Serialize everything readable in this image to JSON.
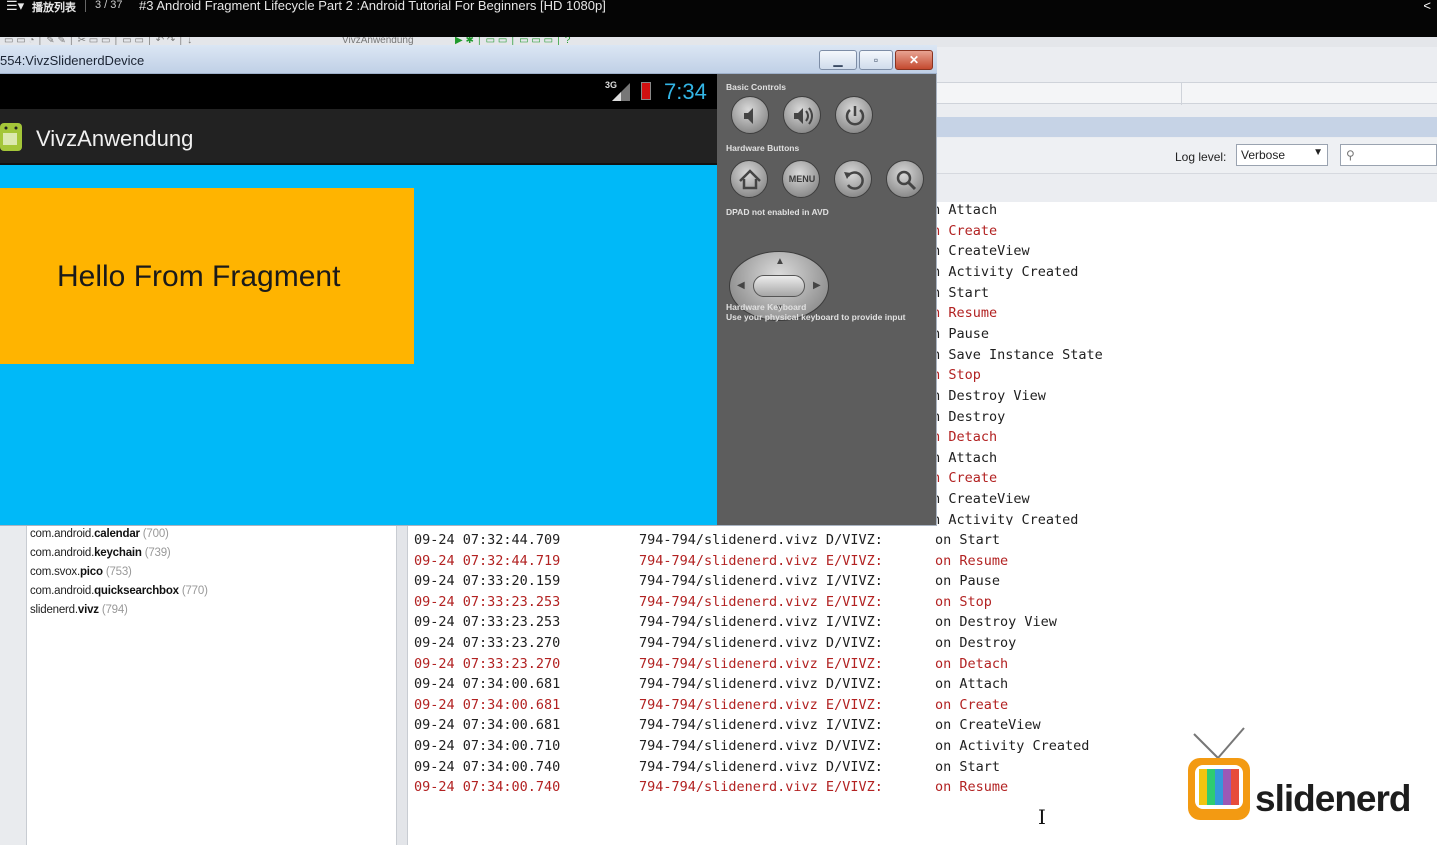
{
  "video_bar": {
    "playlist_icon": "list-icon",
    "playlist_label": "播放列表",
    "position": "3 / 37",
    "title": "#3 Android Fragment Lifecycle Part 2 :Android Tutorial For Beginners [HD 1080p]",
    "share_icon": "share-icon"
  },
  "ide": {
    "toolbar_run_config": "VivzAnwendung",
    "log_level_label": "Log level:",
    "log_level_value": "Verbose",
    "search_icon": "search-icon"
  },
  "emulator": {
    "window_title": "554:VivzSlidenerdDevice",
    "status_net": "3G",
    "clock": "7:34",
    "app_name": "VivzAnwendung",
    "fragment_text": "Hello From Fragment",
    "colors": {
      "content_bg": "#00b9f8",
      "fragment_bg": "#ffb400",
      "actionbar": "#222222"
    },
    "controls": {
      "basic_label": "Basic Controls",
      "hardware_label": "Hardware Buttons",
      "menu_label": "MENU",
      "dpad_label": "DPAD not enabled in AVD",
      "keyboard_label": "Hardware Keyboard",
      "keyboard_sub": "Use your physical keyboard to provide input",
      "icons": [
        "volume-down-icon",
        "volume-up-icon",
        "power-icon",
        "home-icon",
        "menu-icon",
        "back-icon",
        "search-icon"
      ]
    }
  },
  "processes": [
    {
      "prefix": "com.android.",
      "bold": "calendar",
      "pid": "(700)"
    },
    {
      "prefix": "com.android.",
      "bold": "keychain",
      "pid": "(739)"
    },
    {
      "prefix": "com.svox.",
      "bold": "pico",
      "pid": "(753)"
    },
    {
      "prefix": "com.android.",
      "bold": "quicksearchbox",
      "pid": "(770)"
    },
    {
      "prefix": "slidenerd.",
      "bold": "vivz",
      "pid": "(794)"
    }
  ],
  "upper_log_messages": [
    {
      "text": "on Attach",
      "level": "D"
    },
    {
      "text": "on Create",
      "level": "E"
    },
    {
      "text": "on CreateView",
      "level": "I"
    },
    {
      "text": "on Activity Created",
      "level": "D"
    },
    {
      "text": "on Start",
      "level": "D"
    },
    {
      "text": "on Resume",
      "level": "E"
    },
    {
      "text": "on Pause",
      "level": "I"
    },
    {
      "text": "on Save Instance State",
      "level": "D"
    },
    {
      "text": "on Stop",
      "level": "E"
    },
    {
      "text": "on Destroy View",
      "level": "I"
    },
    {
      "text": "on Destroy",
      "level": "D"
    },
    {
      "text": "on Detach",
      "level": "E"
    },
    {
      "text": "on Attach",
      "level": "D"
    },
    {
      "text": "on Create",
      "level": "E"
    },
    {
      "text": "on CreateView",
      "level": "I"
    },
    {
      "text": "on Activity Created",
      "level": "D"
    }
  ],
  "log_lines": [
    {
      "time": "09-24 07:32:44.709",
      "tag": "794-794/slidenerd.vivz D/VIVZ:",
      "msg": "on Start",
      "level": "D"
    },
    {
      "time": "09-24 07:32:44.719",
      "tag": "794-794/slidenerd.vivz E/VIVZ:",
      "msg": "on Resume",
      "level": "E"
    },
    {
      "time": "09-24 07:33:20.159",
      "tag": "794-794/slidenerd.vivz I/VIVZ:",
      "msg": "on Pause",
      "level": "I"
    },
    {
      "time": "09-24 07:33:23.253",
      "tag": "794-794/slidenerd.vivz E/VIVZ:",
      "msg": "on Stop",
      "level": "E"
    },
    {
      "time": "09-24 07:33:23.253",
      "tag": "794-794/slidenerd.vivz I/VIVZ:",
      "msg": "on Destroy View",
      "level": "I"
    },
    {
      "time": "09-24 07:33:23.270",
      "tag": "794-794/slidenerd.vivz D/VIVZ:",
      "msg": "on Destroy",
      "level": "D"
    },
    {
      "time": "09-24 07:33:23.270",
      "tag": "794-794/slidenerd.vivz E/VIVZ:",
      "msg": "on Detach",
      "level": "E"
    },
    {
      "time": "09-24 07:34:00.681",
      "tag": "794-794/slidenerd.vivz D/VIVZ:",
      "msg": "on Attach",
      "level": "D"
    },
    {
      "time": "09-24 07:34:00.681",
      "tag": "794-794/slidenerd.vivz E/VIVZ:",
      "msg": "on Create",
      "level": "E"
    },
    {
      "time": "09-24 07:34:00.681",
      "tag": "794-794/slidenerd.vivz I/VIVZ:",
      "msg": "on CreateView",
      "level": "I"
    },
    {
      "time": "09-24 07:34:00.710",
      "tag": "794-794/slidenerd.vivz D/VIVZ:",
      "msg": "on Activity Created",
      "level": "D"
    },
    {
      "time": "09-24 07:34:00.740",
      "tag": "794-794/slidenerd.vivz D/VIVZ:",
      "msg": "on Start",
      "level": "D"
    },
    {
      "time": "09-24 07:34:00.740",
      "tag": "794-794/slidenerd.vivz E/VIVZ:",
      "msg": "on Resume",
      "level": "E"
    }
  ],
  "log_colors": {
    "D": "#202020",
    "I": "#202020",
    "E": "#b22222"
  },
  "logo": {
    "text": "slidenerd",
    "icon": "tv-icon"
  }
}
